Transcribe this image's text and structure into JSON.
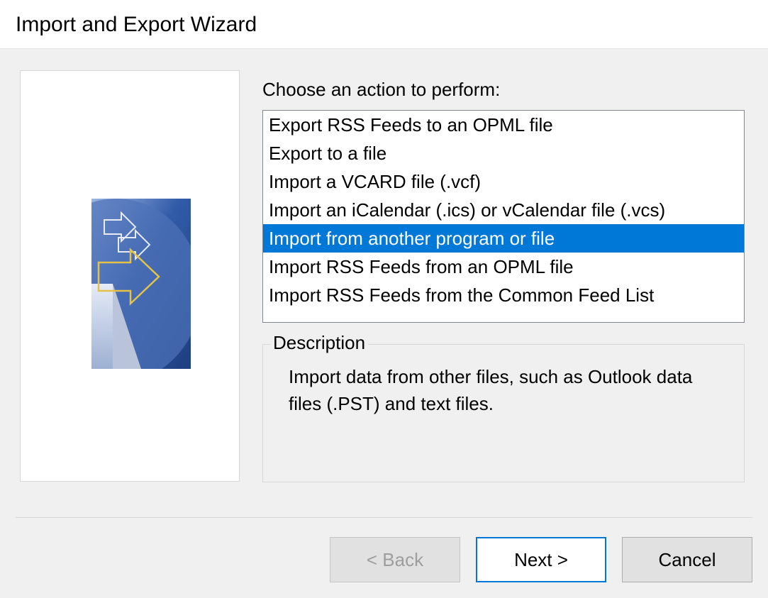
{
  "window": {
    "title": "Import and Export Wizard"
  },
  "main": {
    "instruction": "Choose an action to perform:",
    "actions": [
      "Export RSS Feeds to an OPML file",
      "Export to a file",
      "Import a VCARD file (.vcf)",
      "Import an iCalendar (.ics) or vCalendar file (.vcs)",
      "Import from another program or file",
      "Import RSS Feeds from an OPML file",
      "Import RSS Feeds from the Common Feed List"
    ],
    "selected_index": 4,
    "description_label": "Description",
    "description_text": "Import data from other files, such as Outlook data files (.PST) and text files."
  },
  "buttons": {
    "back": "< Back",
    "next": "Next >",
    "cancel": "Cancel"
  }
}
